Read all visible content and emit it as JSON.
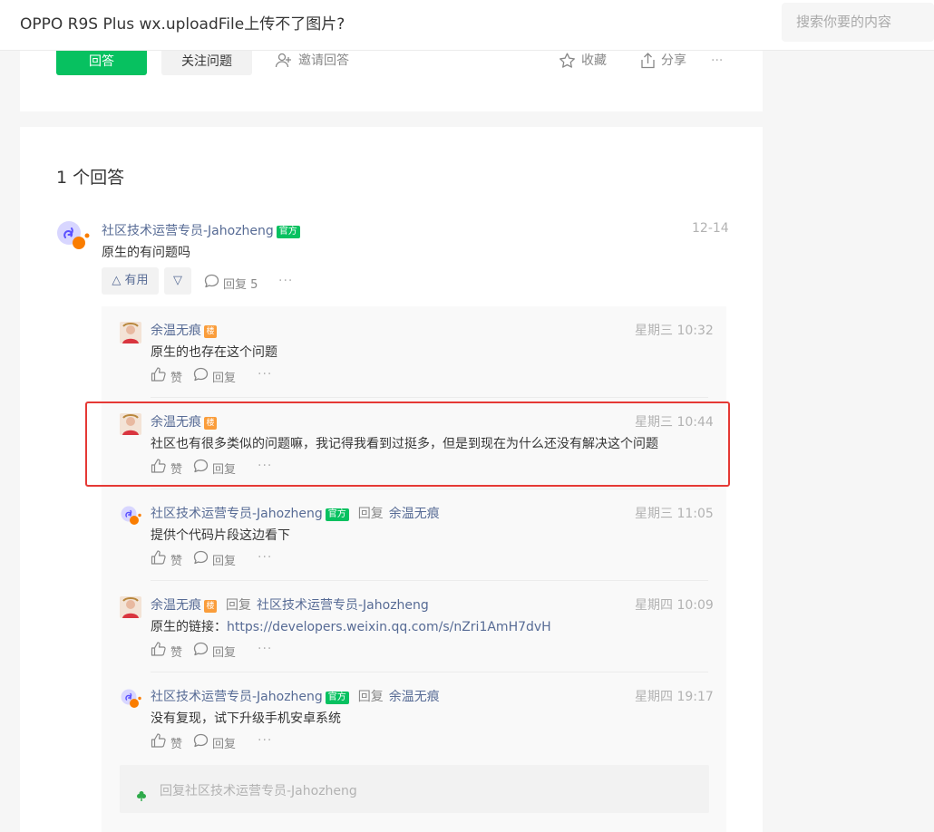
{
  "header": {
    "title": "OPPO R9S Plus wx.uploadFile上传不了图片?",
    "search_placeholder": "搜索你要的内容"
  },
  "question_actions": {
    "answer": "回答",
    "follow": "关注问题",
    "invite": "邀请回答",
    "collect": "收藏",
    "share": "分享",
    "more": "···"
  },
  "answers": {
    "count_label": "1 个回答",
    "item": {
      "author": "社区技术运营专员-Jahozheng",
      "official_badge": "官方",
      "time": "12-14",
      "content": "原生的有问题吗",
      "useful_label": "△ 有用",
      "down_label": "▽",
      "reply_label": "回复 5",
      "more": "···"
    }
  },
  "replies": [
    {
      "author": "余温无痕",
      "badge": "楼",
      "reply_label": "",
      "reply_to": "",
      "time": "星期三 10:32",
      "content": "原生的也存在这个问题",
      "link": "",
      "like": "赞",
      "reply": "回复",
      "more": "···"
    },
    {
      "author": "余温无痕",
      "badge": "楼",
      "reply_label": "",
      "reply_to": "",
      "time": "星期三 10:44",
      "content": "社区也有很多类似的问题嘛，我记得我看到过挺多，但是到现在为什么还没有解决这个问题",
      "link": "",
      "like": "赞",
      "reply": "回复",
      "more": "···"
    },
    {
      "author": "社区技术运营专员-Jahozheng",
      "badge": "官方",
      "reply_label": "回复",
      "reply_to": "余温无痕",
      "time": "星期三 11:05",
      "content": "提供个代码片段这边看下",
      "link": "",
      "like": "赞",
      "reply": "回复",
      "more": "···"
    },
    {
      "author": "余温无痕",
      "badge": "楼",
      "reply_label": "回复",
      "reply_to": "社区技术运营专员-Jahozheng",
      "time": "星期四 10:09",
      "content": "原生的链接：",
      "link": "https://developers.weixin.qq.com/s/nZri1AmH7dvH",
      "like": "赞",
      "reply": "回复",
      "more": "···"
    },
    {
      "author": "社区技术运营专员-Jahozheng",
      "badge": "官方",
      "reply_label": "回复",
      "reply_to": "余温无痕",
      "time": "星期四 19:17",
      "content": "没有复现，试下升级手机安卓系统",
      "link": "",
      "like": "赞",
      "reply": "回复",
      "more": "···"
    }
  ],
  "reply_input": {
    "placeholder": "回复社区技术运营专员-Jahozheng"
  },
  "colors": {
    "accent_green": "#07c160",
    "link_blue": "#576b95",
    "badge_orange": "#fa9d3b",
    "highlight_red": "#e53935"
  }
}
